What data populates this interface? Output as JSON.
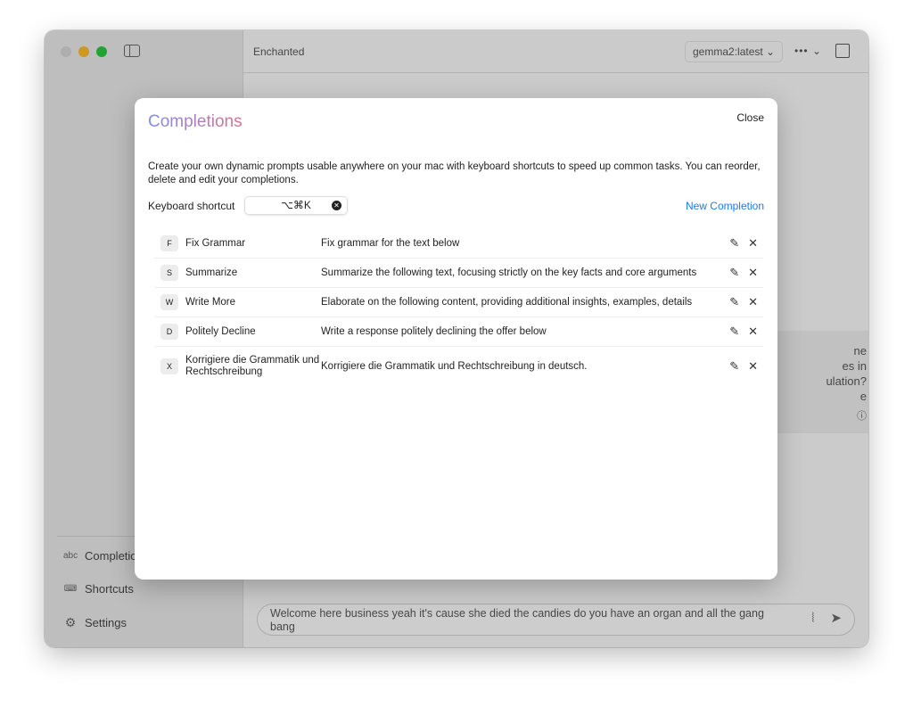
{
  "window": {
    "title": "Enchanted",
    "model": "gemma2:latest",
    "more": "••• ⌄",
    "traffic_colors": [
      "#d0d0d0",
      "#f5b52c",
      "#2ac33f"
    ]
  },
  "sidebar": {
    "items": [
      {
        "icon": "abc",
        "label": "Completions"
      },
      {
        "icon": "keyboard-icon",
        "label": "Shortcuts"
      },
      {
        "icon": "gear-icon",
        "label": "Settings"
      }
    ]
  },
  "background_card": {
    "lines": [
      "ne",
      "es in",
      "ulation?",
      "e"
    ]
  },
  "composer": {
    "value": "Welcome here business yeah it's cause she died the candies do you have an organ and all the gang bang"
  },
  "modal": {
    "title": "Completions",
    "close_label": "Close",
    "description": "Create your own dynamic prompts usable anywhere on your mac with keyboard shortcuts to speed up common tasks. You can reorder, delete and edit your completions.",
    "shortcut_label": "Keyboard shortcut",
    "shortcut_value": "⌥⌘K",
    "new_label": "New Completion",
    "accent": "#1a7cf2",
    "completions": [
      {
        "key": "F",
        "name": "Fix Grammar",
        "prompt": "Fix grammar for the text below"
      },
      {
        "key": "S",
        "name": "Summarize",
        "prompt": "Summarize the following text, focusing strictly on the key facts and core arguments"
      },
      {
        "key": "W",
        "name": "Write More",
        "prompt": "Elaborate on the following content, providing additional insights, examples, details"
      },
      {
        "key": "D",
        "name": "Politely Decline",
        "prompt": "Write a response politely declining the offer below"
      },
      {
        "key": "X",
        "name": "Korrigiere die Grammatik und Rechtschreibung",
        "prompt": "Korrigiere die Grammatik und Rechtschreibung in deutsch."
      }
    ]
  }
}
